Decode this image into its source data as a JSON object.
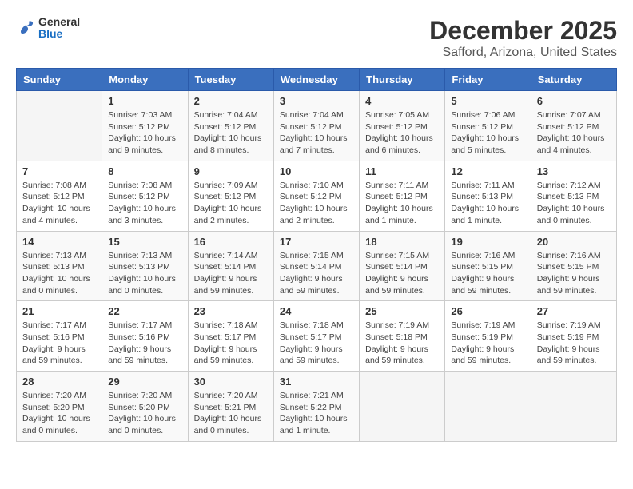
{
  "logo": {
    "general": "General",
    "blue": "Blue"
  },
  "header": {
    "title": "December 2025",
    "subtitle": "Safford, Arizona, United States"
  },
  "weekdays": [
    "Sunday",
    "Monday",
    "Tuesday",
    "Wednesday",
    "Thursday",
    "Friday",
    "Saturday"
  ],
  "weeks": [
    [
      {
        "day": "",
        "sunrise": "",
        "sunset": "",
        "daylight": ""
      },
      {
        "day": "1",
        "sunrise": "Sunrise: 7:03 AM",
        "sunset": "Sunset: 5:12 PM",
        "daylight": "Daylight: 10 hours and 9 minutes."
      },
      {
        "day": "2",
        "sunrise": "Sunrise: 7:04 AM",
        "sunset": "Sunset: 5:12 PM",
        "daylight": "Daylight: 10 hours and 8 minutes."
      },
      {
        "day": "3",
        "sunrise": "Sunrise: 7:04 AM",
        "sunset": "Sunset: 5:12 PM",
        "daylight": "Daylight: 10 hours and 7 minutes."
      },
      {
        "day": "4",
        "sunrise": "Sunrise: 7:05 AM",
        "sunset": "Sunset: 5:12 PM",
        "daylight": "Daylight: 10 hours and 6 minutes."
      },
      {
        "day": "5",
        "sunrise": "Sunrise: 7:06 AM",
        "sunset": "Sunset: 5:12 PM",
        "daylight": "Daylight: 10 hours and 5 minutes."
      },
      {
        "day": "6",
        "sunrise": "Sunrise: 7:07 AM",
        "sunset": "Sunset: 5:12 PM",
        "daylight": "Daylight: 10 hours and 4 minutes."
      }
    ],
    [
      {
        "day": "7",
        "sunrise": "Sunrise: 7:08 AM",
        "sunset": "Sunset: 5:12 PM",
        "daylight": "Daylight: 10 hours and 4 minutes."
      },
      {
        "day": "8",
        "sunrise": "Sunrise: 7:08 AM",
        "sunset": "Sunset: 5:12 PM",
        "daylight": "Daylight: 10 hours and 3 minutes."
      },
      {
        "day": "9",
        "sunrise": "Sunrise: 7:09 AM",
        "sunset": "Sunset: 5:12 PM",
        "daylight": "Daylight: 10 hours and 2 minutes."
      },
      {
        "day": "10",
        "sunrise": "Sunrise: 7:10 AM",
        "sunset": "Sunset: 5:12 PM",
        "daylight": "Daylight: 10 hours and 2 minutes."
      },
      {
        "day": "11",
        "sunrise": "Sunrise: 7:11 AM",
        "sunset": "Sunset: 5:12 PM",
        "daylight": "Daylight: 10 hours and 1 minute."
      },
      {
        "day": "12",
        "sunrise": "Sunrise: 7:11 AM",
        "sunset": "Sunset: 5:13 PM",
        "daylight": "Daylight: 10 hours and 1 minute."
      },
      {
        "day": "13",
        "sunrise": "Sunrise: 7:12 AM",
        "sunset": "Sunset: 5:13 PM",
        "daylight": "Daylight: 10 hours and 0 minutes."
      }
    ],
    [
      {
        "day": "14",
        "sunrise": "Sunrise: 7:13 AM",
        "sunset": "Sunset: 5:13 PM",
        "daylight": "Daylight: 10 hours and 0 minutes."
      },
      {
        "day": "15",
        "sunrise": "Sunrise: 7:13 AM",
        "sunset": "Sunset: 5:13 PM",
        "daylight": "Daylight: 10 hours and 0 minutes."
      },
      {
        "day": "16",
        "sunrise": "Sunrise: 7:14 AM",
        "sunset": "Sunset: 5:14 PM",
        "daylight": "Daylight: 9 hours and 59 minutes."
      },
      {
        "day": "17",
        "sunrise": "Sunrise: 7:15 AM",
        "sunset": "Sunset: 5:14 PM",
        "daylight": "Daylight: 9 hours and 59 minutes."
      },
      {
        "day": "18",
        "sunrise": "Sunrise: 7:15 AM",
        "sunset": "Sunset: 5:14 PM",
        "daylight": "Daylight: 9 hours and 59 minutes."
      },
      {
        "day": "19",
        "sunrise": "Sunrise: 7:16 AM",
        "sunset": "Sunset: 5:15 PM",
        "daylight": "Daylight: 9 hours and 59 minutes."
      },
      {
        "day": "20",
        "sunrise": "Sunrise: 7:16 AM",
        "sunset": "Sunset: 5:15 PM",
        "daylight": "Daylight: 9 hours and 59 minutes."
      }
    ],
    [
      {
        "day": "21",
        "sunrise": "Sunrise: 7:17 AM",
        "sunset": "Sunset: 5:16 PM",
        "daylight": "Daylight: 9 hours and 59 minutes."
      },
      {
        "day": "22",
        "sunrise": "Sunrise: 7:17 AM",
        "sunset": "Sunset: 5:16 PM",
        "daylight": "Daylight: 9 hours and 59 minutes."
      },
      {
        "day": "23",
        "sunrise": "Sunrise: 7:18 AM",
        "sunset": "Sunset: 5:17 PM",
        "daylight": "Daylight: 9 hours and 59 minutes."
      },
      {
        "day": "24",
        "sunrise": "Sunrise: 7:18 AM",
        "sunset": "Sunset: 5:17 PM",
        "daylight": "Daylight: 9 hours and 59 minutes."
      },
      {
        "day": "25",
        "sunrise": "Sunrise: 7:19 AM",
        "sunset": "Sunset: 5:18 PM",
        "daylight": "Daylight: 9 hours and 59 minutes."
      },
      {
        "day": "26",
        "sunrise": "Sunrise: 7:19 AM",
        "sunset": "Sunset: 5:19 PM",
        "daylight": "Daylight: 9 hours and 59 minutes."
      },
      {
        "day": "27",
        "sunrise": "Sunrise: 7:19 AM",
        "sunset": "Sunset: 5:19 PM",
        "daylight": "Daylight: 9 hours and 59 minutes."
      }
    ],
    [
      {
        "day": "28",
        "sunrise": "Sunrise: 7:20 AM",
        "sunset": "Sunset: 5:20 PM",
        "daylight": "Daylight: 10 hours and 0 minutes."
      },
      {
        "day": "29",
        "sunrise": "Sunrise: 7:20 AM",
        "sunset": "Sunset: 5:20 PM",
        "daylight": "Daylight: 10 hours and 0 minutes."
      },
      {
        "day": "30",
        "sunrise": "Sunrise: 7:20 AM",
        "sunset": "Sunset: 5:21 PM",
        "daylight": "Daylight: 10 hours and 0 minutes."
      },
      {
        "day": "31",
        "sunrise": "Sunrise: 7:21 AM",
        "sunset": "Sunset: 5:22 PM",
        "daylight": "Daylight: 10 hours and 1 minute."
      },
      {
        "day": "",
        "sunrise": "",
        "sunset": "",
        "daylight": ""
      },
      {
        "day": "",
        "sunrise": "",
        "sunset": "",
        "daylight": ""
      },
      {
        "day": "",
        "sunrise": "",
        "sunset": "",
        "daylight": ""
      }
    ]
  ]
}
